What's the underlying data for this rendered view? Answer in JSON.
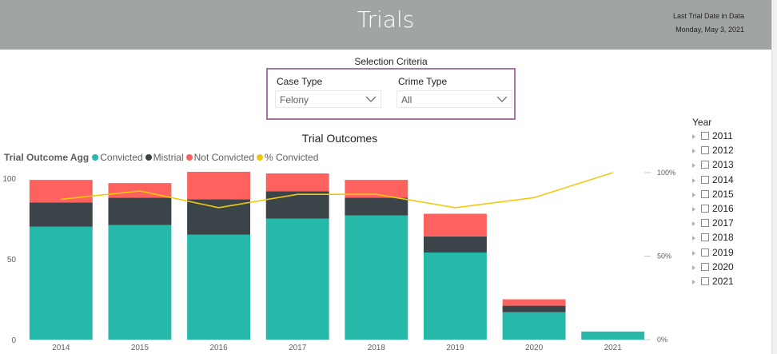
{
  "header": {
    "title": "Trials",
    "last_date_label": "Last Trial Date in Data",
    "last_date_value": "Monday, May 3, 2021",
    "bg_color": "#a0a5a4"
  },
  "selection": {
    "title": "Selection Criteria",
    "case_type": {
      "label": "Case Type",
      "value": "Felony"
    },
    "crime_type": {
      "label": "Crime Type",
      "value": "All"
    },
    "border_color": "#a476a7"
  },
  "year_filter": {
    "title": "Year",
    "years": [
      "2011",
      "2012",
      "2013",
      "2014",
      "2015",
      "2016",
      "2017",
      "2018",
      "2019",
      "2020",
      "2021"
    ]
  },
  "legend": {
    "title": "Trial Outcome Agg",
    "items": [
      {
        "label": "Convicted",
        "color": "#26b8a9"
      },
      {
        "label": "Mistrial",
        "color": "#3a4449"
      },
      {
        "label": "Not Convicted",
        "color": "#fd625e"
      },
      {
        "label": "% Convicted",
        "color": "#f2c80f"
      }
    ]
  },
  "chart_data": {
    "type": "bar",
    "stacked": true,
    "title": "Trial Outcomes",
    "categories": [
      "2014",
      "2015",
      "2016",
      "2017",
      "2018",
      "2019",
      "2020",
      "2021"
    ],
    "series": [
      {
        "name": "Convicted",
        "values": [
          70,
          71,
          65,
          75,
          77,
          54,
          17,
          5
        ]
      },
      {
        "name": "Mistrial",
        "values": [
          15,
          17,
          22,
          17,
          11,
          10,
          4,
          0
        ]
      },
      {
        "name": "Not Convicted",
        "values": [
          14,
          9,
          17,
          11,
          11,
          14,
          4,
          0
        ]
      }
    ],
    "line_series": {
      "name": "% Convicted",
      "values": [
        84,
        89,
        79,
        87,
        87,
        79,
        85,
        100
      ]
    },
    "y_ticks": [
      0,
      50,
      100
    ],
    "ylim": [
      0,
      105
    ],
    "y2_ticks": [
      "0%",
      "50%",
      "100%"
    ],
    "y2lim": [
      0,
      100
    ],
    "colors": {
      "Convicted": "#26b8a9",
      "Mistrial": "#3a4449",
      "Not Convicted": "#fd625e",
      "% Convicted": "#f2c80f"
    }
  }
}
